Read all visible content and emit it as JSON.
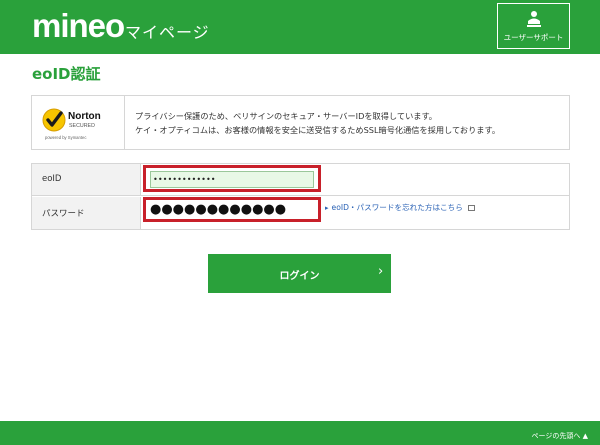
{
  "header": {
    "logo": "mineo",
    "title": "マイページ",
    "support_label": "ユーザーサポート"
  },
  "page_title": "eoID認証",
  "norton": {
    "logo_line1": "Norton",
    "logo_line2": "SECURED",
    "logo_line3": "powered by Symantec",
    "text_line1": "プライバシー保護のため、ベリサインのセキュア・サーバーIDを取得しています。",
    "text_line2": "ケイ・オプティコムは、お客様の情報を安全に送受信するためSSL暗号化通信を採用しております。"
  },
  "form": {
    "eoid_label": "eoID",
    "eoid_value": "•••••••••••••",
    "password_label": "パスワード",
    "password_value": "●●●●●●●●●●●●",
    "forgot_link": "eoID・パスワードを忘れた方はこちら"
  },
  "login_button": {
    "label": "ログイン",
    "chevron": "›"
  },
  "footer": {
    "to_top": "ページの先頭へ ▲"
  },
  "colors": {
    "brand_green": "#2aa13b",
    "highlight_red": "#c8202a",
    "link_blue": "#2a62b5"
  }
}
